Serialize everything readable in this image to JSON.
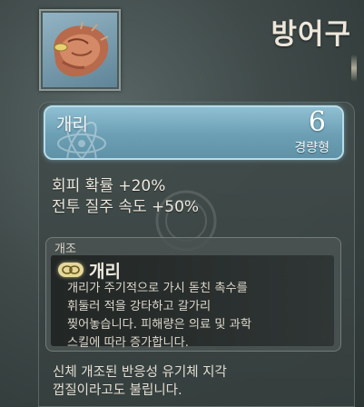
{
  "category": {
    "title": "방어구"
  },
  "item": {
    "name": "개리",
    "weight_value": "6",
    "weight_class": "경량형",
    "icon": "flesh-armor-icon"
  },
  "stats": [
    "회피 확률 +20%",
    "전투 질주 속도 +50%"
  ],
  "modification": {
    "section_label": "개조",
    "icon": "mod-capsule-icon",
    "name": "개리",
    "description_lines": [
      "개리가 주기적으로 가시 돋친 촉수를",
      "휘둘러 적을 강타하고 갈가리",
      "찢어놓습니다. 피해량은 의료 및 과학",
      "스킬에 따라 증가합니다."
    ]
  },
  "flavor_lines": [
    "신체 개조된 반응성 유기체 지각",
    "껍질이라고도 불립니다."
  ],
  "colors": {
    "header_accent": "#8fbfd2",
    "mod_icon": "#e6d89a"
  }
}
